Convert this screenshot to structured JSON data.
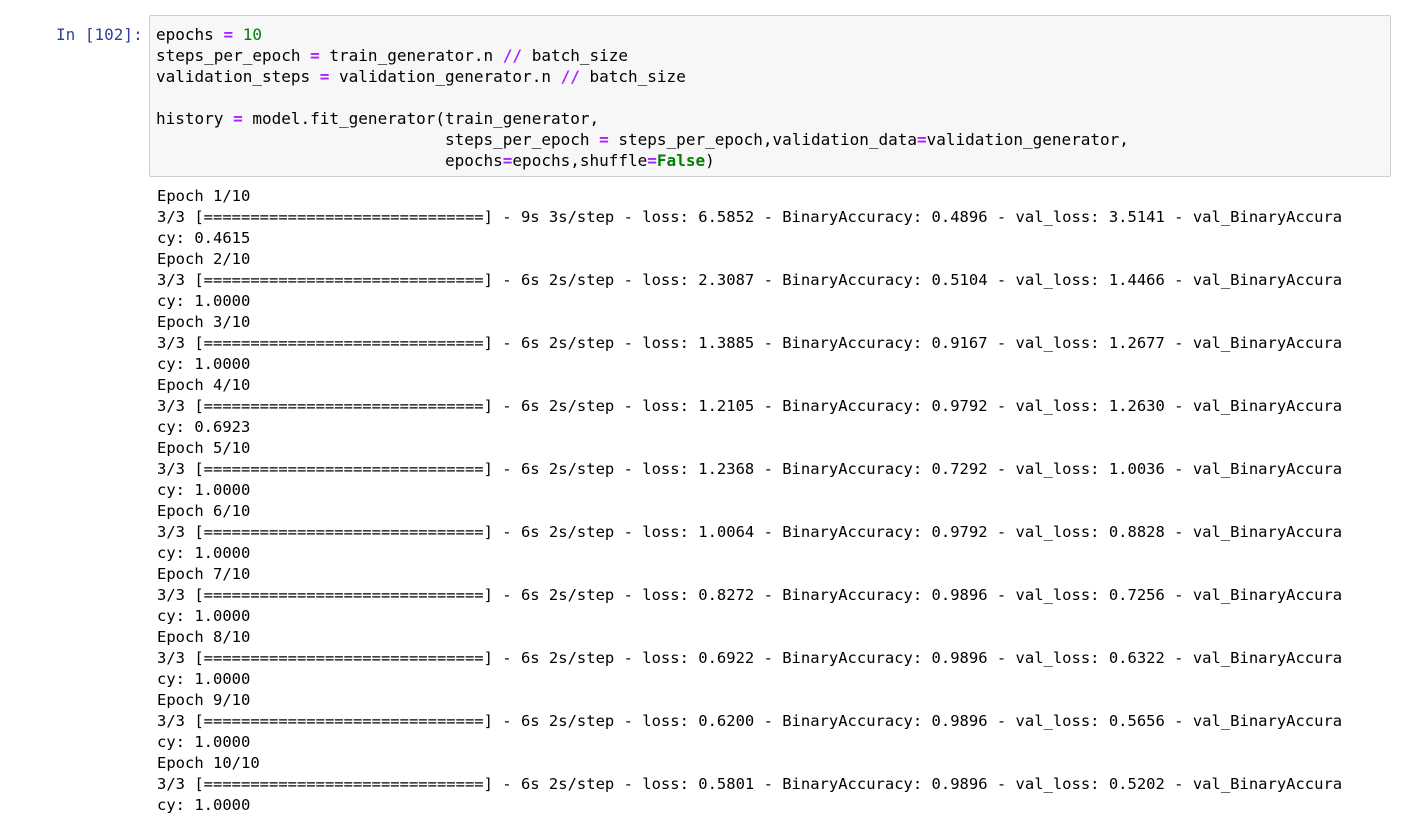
{
  "cell": {
    "prompt": "In [102]:",
    "code_lines": [
      [
        {
          "t": "epochs "
        },
        {
          "t": "=",
          "c": "op"
        },
        {
          "t": " "
        },
        {
          "t": "10",
          "c": "num"
        }
      ],
      [
        {
          "t": "steps_per_epoch "
        },
        {
          "t": "=",
          "c": "op"
        },
        {
          "t": " train_generator.n "
        },
        {
          "t": "//",
          "c": "op"
        },
        {
          "t": " batch_size"
        }
      ],
      [
        {
          "t": "validation_steps "
        },
        {
          "t": "=",
          "c": "op"
        },
        {
          "t": " validation_generator.n "
        },
        {
          "t": "//",
          "c": "op"
        },
        {
          "t": " batch_size"
        }
      ],
      [],
      [
        {
          "t": "history "
        },
        {
          "t": "=",
          "c": "op"
        },
        {
          "t": " model.fit_generator(train_generator,"
        }
      ],
      [
        {
          "t": "                              steps_per_epoch "
        },
        {
          "t": "=",
          "c": "op"
        },
        {
          "t": " steps_per_epoch,validation_data"
        },
        {
          "t": "=",
          "c": "op"
        },
        {
          "t": "validation_generator,"
        }
      ],
      [
        {
          "t": "                              epochs"
        },
        {
          "t": "=",
          "c": "op"
        },
        {
          "t": "epochs,shuffle"
        },
        {
          "t": "=",
          "c": "op"
        },
        {
          "t": "False",
          "c": "kw"
        },
        {
          "t": ")"
        }
      ]
    ]
  },
  "output": {
    "lines": [
      "Epoch 1/10",
      "3/3 [==============================] - 9s 3s/step - loss: 6.5852 - BinaryAccuracy: 0.4896 - val_loss: 3.5141 - val_BinaryAccura",
      "cy: 0.4615",
      "Epoch 2/10",
      "3/3 [==============================] - 6s 2s/step - loss: 2.3087 - BinaryAccuracy: 0.5104 - val_loss: 1.4466 - val_BinaryAccura",
      "cy: 1.0000",
      "Epoch 3/10",
      "3/3 [==============================] - 6s 2s/step - loss: 1.3885 - BinaryAccuracy: 0.9167 - val_loss: 1.2677 - val_BinaryAccura",
      "cy: 1.0000",
      "Epoch 4/10",
      "3/3 [==============================] - 6s 2s/step - loss: 1.2105 - BinaryAccuracy: 0.9792 - val_loss: 1.2630 - val_BinaryAccura",
      "cy: 0.6923",
      "Epoch 5/10",
      "3/3 [==============================] - 6s 2s/step - loss: 1.2368 - BinaryAccuracy: 0.7292 - val_loss: 1.0036 - val_BinaryAccura",
      "cy: 1.0000",
      "Epoch 6/10",
      "3/3 [==============================] - 6s 2s/step - loss: 1.0064 - BinaryAccuracy: 0.9792 - val_loss: 0.8828 - val_BinaryAccura",
      "cy: 1.0000",
      "Epoch 7/10",
      "3/3 [==============================] - 6s 2s/step - loss: 0.8272 - BinaryAccuracy: 0.9896 - val_loss: 0.7256 - val_BinaryAccura",
      "cy: 1.0000",
      "Epoch 8/10",
      "3/3 [==============================] - 6s 2s/step - loss: 0.6922 - BinaryAccuracy: 0.9896 - val_loss: 0.6322 - val_BinaryAccura",
      "cy: 1.0000",
      "Epoch 9/10",
      "3/3 [==============================] - 6s 2s/step - loss: 0.6200 - BinaryAccuracy: 0.9896 - val_loss: 0.5656 - val_BinaryAccura",
      "cy: 1.0000",
      "Epoch 10/10",
      "3/3 [==============================] - 6s 2s/step - loss: 0.5801 - BinaryAccuracy: 0.9896 - val_loss: 0.5202 - val_BinaryAccura",
      "cy: 1.0000"
    ]
  },
  "colors": {
    "prompt": "#303f9f",
    "input_background": "#f7f7f7",
    "input_border": "#cfcfcf",
    "operator": "#aa22ff",
    "number": "#008000",
    "keyword": "#008000"
  }
}
